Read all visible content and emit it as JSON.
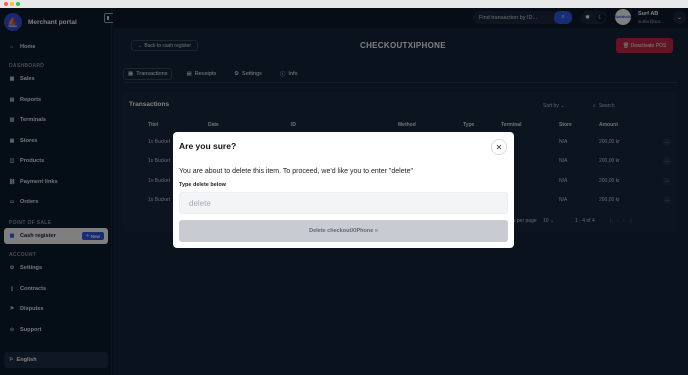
{
  "sidebar": {
    "brand": "Merchant portal",
    "items": [
      {
        "label": "Home",
        "icon": "home-icon"
      },
      {
        "label": "Sales",
        "icon": "sales-icon"
      },
      {
        "label": "Reports",
        "icon": "reports-icon"
      },
      {
        "label": "Terminals",
        "icon": "terminals-icon"
      },
      {
        "label": "Stores",
        "icon": "stores-icon"
      },
      {
        "label": "Products",
        "icon": "products-icon"
      },
      {
        "label": "Payment links",
        "icon": "link-icon"
      },
      {
        "label": "Orders",
        "icon": "orders-icon"
      },
      {
        "label": "Cash register",
        "icon": "cash-register-icon",
        "badge": "New"
      },
      {
        "label": "Settings",
        "icon": "gear-icon"
      },
      {
        "label": "Contracts",
        "icon": "contracts-icon"
      },
      {
        "label": "Disputes",
        "icon": "disputes-icon"
      },
      {
        "label": "Support",
        "icon": "support-icon"
      }
    ],
    "sections": {
      "dashboard": "DASHBOARD",
      "pos": "POINT OF SALE",
      "account": "ACCOUNT"
    },
    "language": "English"
  },
  "header": {
    "search_placeholder": "Find transaction by ID...",
    "user_name": "Surf AB",
    "user_email": "surfer@sur..."
  },
  "main": {
    "back_label": "Back to cash register",
    "title": "CHECKOUTXIPHONE",
    "delete_label": "Deactivate POS",
    "tabs": [
      "Transactions",
      "Receipts",
      "Settings",
      "Info"
    ],
    "card_title": "Transactions",
    "sort_label": "Sort by",
    "search_placeholder": "Search",
    "columns": [
      "Titel",
      "Date",
      "ID",
      "Method",
      "Type",
      "Terminal",
      "Store",
      "Amount"
    ],
    "rows": [
      {
        "title": "1x Bucket",
        "store": "N/A",
        "amount": "200,00 kr"
      },
      {
        "title": "1x Bucket",
        "store": "N/A",
        "amount": "200,00 kr"
      },
      {
        "title": "1x Bucket",
        "store": "N/A",
        "amount": "200,00 kr"
      },
      {
        "title": "1x Bucket",
        "store": "N/A",
        "amount": "200,00 kr"
      }
    ],
    "rows_per_page_label": "Rows per page",
    "rows_per_page": "10",
    "range": "1 - 4 of 4"
  },
  "modal": {
    "title": "Are you sure?",
    "message": "You are about to delete this item. To proceed, we'd like you to enter \"delete\"",
    "input_label": "Type delete below",
    "input_placeholder": "delete",
    "confirm_label": "Delete checkoutXIPhone »"
  },
  "colors": {
    "accent": "#2f5bea",
    "danger": "#c52a4a",
    "sidebar": "#0b1a2e"
  }
}
